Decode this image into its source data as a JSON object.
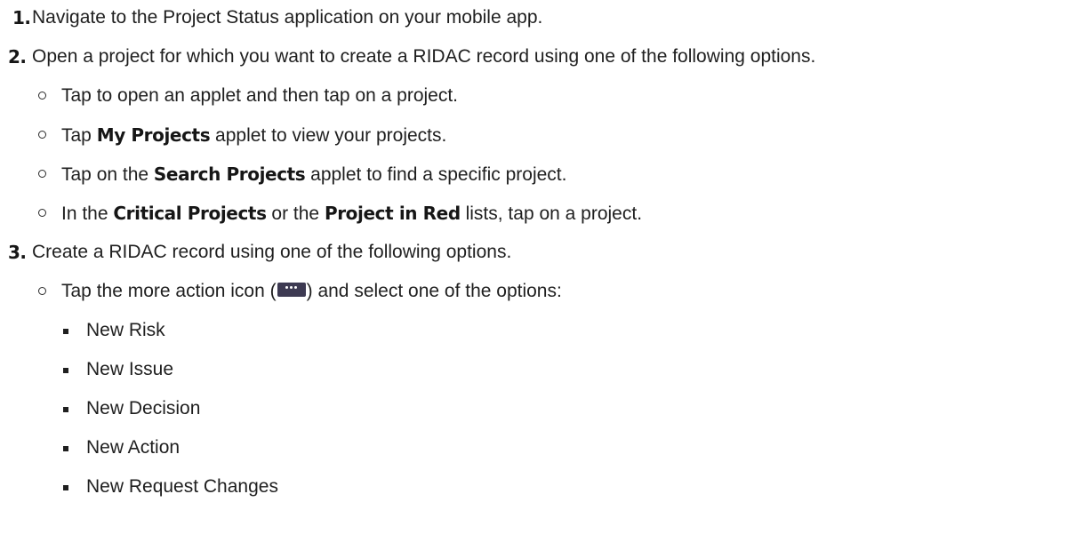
{
  "steps": [
    {
      "number": "1.",
      "text": "Navigate to the Project Status application on your mobile app."
    },
    {
      "number": "2.",
      "text": "Open a project for which you want to create a RIDAC record using one of the following options.",
      "options": [
        {
          "text": "Tap to open an applet and then tap on a project."
        },
        {
          "pre": "Tap ",
          "bold": "My Projects",
          "post": " applet to view your projects."
        },
        {
          "pre": "Tap on the ",
          "bold": "Search Projects",
          "post": " applet to find a specific project."
        },
        {
          "pre": "In the ",
          "bold": "Critical Projects",
          "mid": " or the ",
          "bold2": "Project in Red",
          "post": " lists, tap on a project."
        }
      ]
    },
    {
      "number": "3.",
      "text": "Create a RIDAC record using one of the following options.",
      "option": {
        "pre": "Tap the more action icon (",
        "icon": "more-actions-icon",
        "post": ") and select one of the options:"
      },
      "sub_options": [
        "New Risk",
        "New Issue",
        "New Decision",
        "New Action",
        "New Request Changes"
      ]
    }
  ],
  "colors": {
    "text": "#1f1f1f",
    "icon_background": "#3d3a52"
  }
}
